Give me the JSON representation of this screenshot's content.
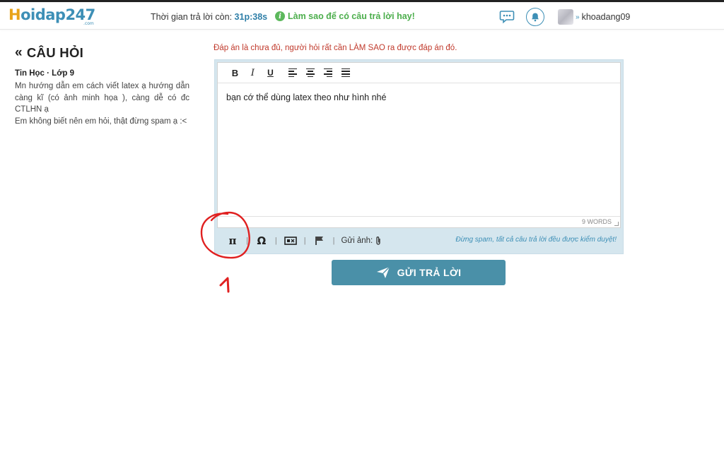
{
  "header": {
    "logo": {
      "first_letter": "H",
      "rest": "oidap247",
      "suffix": ".com"
    },
    "timer_label": "Thời gian trả lời còn:",
    "timer_value": "31p:38s",
    "howto_label": "Làm sao để có câu trả lời hay!",
    "username": "khoadang09",
    "icons": {
      "chat": "chat-bubble-icon",
      "bell": "bell-icon",
      "chevron": "double-chevron-down-icon"
    }
  },
  "question": {
    "heading_prefix": "«",
    "heading": "CÂU HỎI",
    "subject": "Tin Học · Lớp 9",
    "body_line_1": "Mn hướng dẫn em cách viết latex ạ hướng dẫn càng kĩ (có ảnh minh họa ), càng dễ có đc CTLHN ạ",
    "body_line_2": "Em không biết nên em hỏi, thật đừng spam ạ :<"
  },
  "editor": {
    "warning": "Đáp án là chưa đủ, người hỏi rất cần LÀM SAO ra được đáp án đó.",
    "toolbar": {
      "bold": "B",
      "italic": "I",
      "underline": "U"
    },
    "content": "bạn cớ thể dùng latex theo như hình nhé",
    "word_count": "9 WORDS",
    "bottom": {
      "pi": "π",
      "omega": "Ω",
      "send_image_label": "Gửi ảnh:",
      "anti_spam_note": "Đừng spam, tất cả câu trả lời đều được kiểm duyệt!"
    }
  },
  "submit_label": "GỬI TRẢ LỜI",
  "annotation": {
    "label": "1",
    "color": "#e02020"
  },
  "colors": {
    "accent": "#3d8fb6",
    "button": "#4a90a8",
    "warning": "#c0392b",
    "success": "#4cae4c",
    "logo_h": "#e8a317"
  }
}
